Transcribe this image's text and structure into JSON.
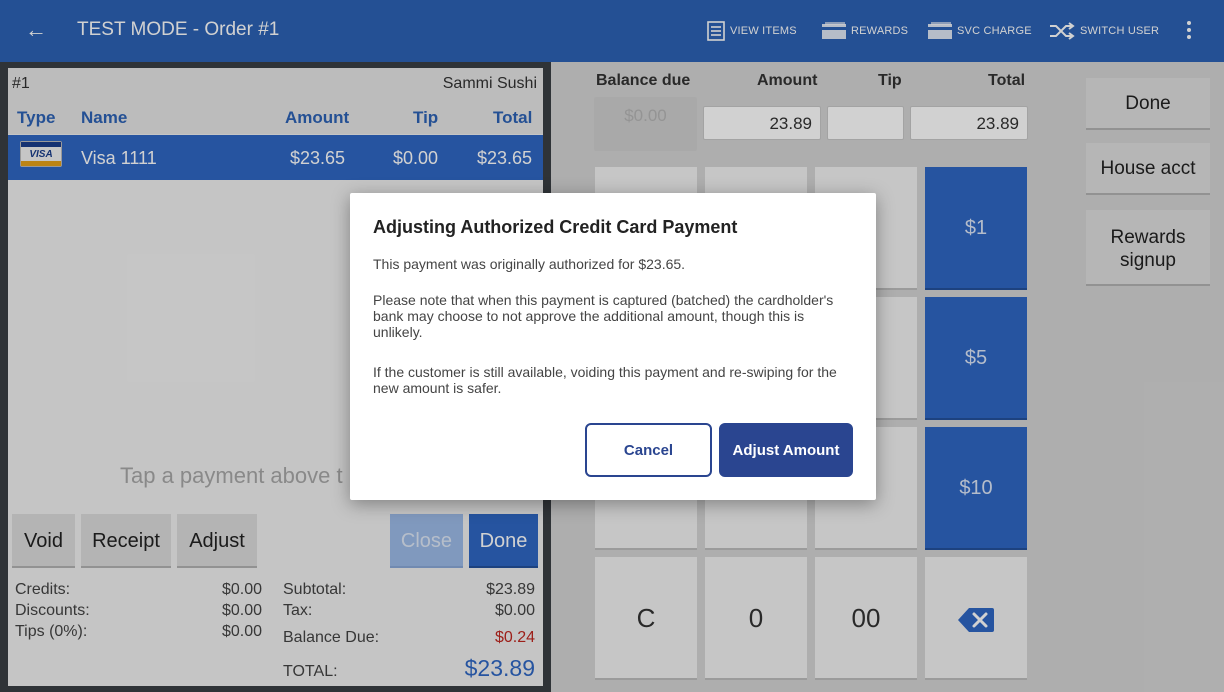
{
  "topbar": {
    "title": "TEST MODE - Order #1",
    "actions": [
      {
        "label": "VIEW ITEMS",
        "icon": "list-icon"
      },
      {
        "label": "REWARDS",
        "icon": "card-icon"
      },
      {
        "label": "SVC CHARGE",
        "icon": "card-icon"
      },
      {
        "label": "SWITCH USER",
        "icon": "shuffle-icon"
      }
    ]
  },
  "order": {
    "number": "#1",
    "restaurant": "Sammi Sushi",
    "columns": [
      "Type",
      "Name",
      "Amount",
      "Tip",
      "Total"
    ],
    "payments": [
      {
        "type": "VISA",
        "name": "Visa 1111",
        "amount": "$23.65",
        "tip": "$0.00",
        "total": "$23.65"
      }
    ],
    "hint": "Tap a payment above t",
    "buttons": {
      "void": "Void",
      "receipt": "Receipt",
      "adjust": "Adjust",
      "close": "Close",
      "done": "Done"
    }
  },
  "totals": {
    "credits_label": "Credits:",
    "credits": "$0.00",
    "discounts_label": "Discounts:",
    "discounts": "$0.00",
    "tips_label": "Tips (0%):",
    "tips": "$0.00",
    "subtotal_label": "Subtotal:",
    "subtotal": "$23.89",
    "tax_label": "Tax:",
    "tax": "$0.00",
    "balance_label": "Balance Due:",
    "balance": "$0.24",
    "total_label": "TOTAL:",
    "total": "$23.89"
  },
  "entry": {
    "headers": {
      "balance_due": "Balance due",
      "amount": "Amount",
      "tip": "Tip",
      "total": "Total"
    },
    "balance_due": "$0.00",
    "amount": "23.89",
    "tip": "",
    "total": "23.89"
  },
  "keypad": {
    "quick": [
      "$1",
      "$5",
      "$10"
    ],
    "bottom": [
      "C",
      "0",
      "00"
    ],
    "backspace_icon": "backspace-icon"
  },
  "side": {
    "done": "Done",
    "house": "House acct",
    "rewards": "Rewards signup"
  },
  "modal": {
    "title": "Adjusting Authorized Credit Card Payment",
    "p1": "This payment was originally authorized for $23.65.",
    "p2": "Please note that when this payment is captured (batched) the cardholder's bank may choose to not approve the additional amount, though this is unlikely.",
    "p3": "If the customer is still available, voiding this payment and re-swiping for the new amount is safer.",
    "cancel": "Cancel",
    "adjust": "Adjust Amount"
  },
  "colors": {
    "primary": "#2d62b5",
    "dialog_button": "#2a4590",
    "balance_red": "#c0261f"
  }
}
